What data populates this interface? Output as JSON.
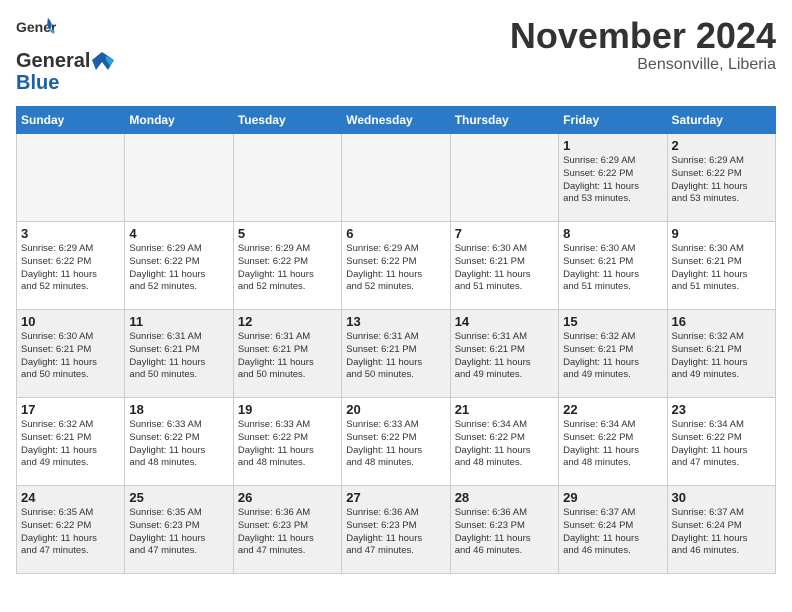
{
  "header": {
    "logo_general": "General",
    "logo_blue": "Blue",
    "month_title": "November 2024",
    "location": "Bensonville, Liberia"
  },
  "days_of_week": [
    "Sunday",
    "Monday",
    "Tuesday",
    "Wednesday",
    "Thursday",
    "Friday",
    "Saturday"
  ],
  "weeks": [
    [
      {
        "day": "",
        "info": "",
        "empty": true
      },
      {
        "day": "",
        "info": "",
        "empty": true
      },
      {
        "day": "",
        "info": "",
        "empty": true
      },
      {
        "day": "",
        "info": "",
        "empty": true
      },
      {
        "day": "",
        "info": "",
        "empty": true
      },
      {
        "day": "1",
        "info": "Sunrise: 6:29 AM\nSunset: 6:22 PM\nDaylight: 11 hours\nand 53 minutes."
      },
      {
        "day": "2",
        "info": "Sunrise: 6:29 AM\nSunset: 6:22 PM\nDaylight: 11 hours\nand 53 minutes."
      }
    ],
    [
      {
        "day": "3",
        "info": "Sunrise: 6:29 AM\nSunset: 6:22 PM\nDaylight: 11 hours\nand 52 minutes."
      },
      {
        "day": "4",
        "info": "Sunrise: 6:29 AM\nSunset: 6:22 PM\nDaylight: 11 hours\nand 52 minutes."
      },
      {
        "day": "5",
        "info": "Sunrise: 6:29 AM\nSunset: 6:22 PM\nDaylight: 11 hours\nand 52 minutes."
      },
      {
        "day": "6",
        "info": "Sunrise: 6:29 AM\nSunset: 6:22 PM\nDaylight: 11 hours\nand 52 minutes."
      },
      {
        "day": "7",
        "info": "Sunrise: 6:30 AM\nSunset: 6:21 PM\nDaylight: 11 hours\nand 51 minutes."
      },
      {
        "day": "8",
        "info": "Sunrise: 6:30 AM\nSunset: 6:21 PM\nDaylight: 11 hours\nand 51 minutes."
      },
      {
        "day": "9",
        "info": "Sunrise: 6:30 AM\nSunset: 6:21 PM\nDaylight: 11 hours\nand 51 minutes."
      }
    ],
    [
      {
        "day": "10",
        "info": "Sunrise: 6:30 AM\nSunset: 6:21 PM\nDaylight: 11 hours\nand 50 minutes."
      },
      {
        "day": "11",
        "info": "Sunrise: 6:31 AM\nSunset: 6:21 PM\nDaylight: 11 hours\nand 50 minutes."
      },
      {
        "day": "12",
        "info": "Sunrise: 6:31 AM\nSunset: 6:21 PM\nDaylight: 11 hours\nand 50 minutes."
      },
      {
        "day": "13",
        "info": "Sunrise: 6:31 AM\nSunset: 6:21 PM\nDaylight: 11 hours\nand 50 minutes."
      },
      {
        "day": "14",
        "info": "Sunrise: 6:31 AM\nSunset: 6:21 PM\nDaylight: 11 hours\nand 49 minutes."
      },
      {
        "day": "15",
        "info": "Sunrise: 6:32 AM\nSunset: 6:21 PM\nDaylight: 11 hours\nand 49 minutes."
      },
      {
        "day": "16",
        "info": "Sunrise: 6:32 AM\nSunset: 6:21 PM\nDaylight: 11 hours\nand 49 minutes."
      }
    ],
    [
      {
        "day": "17",
        "info": "Sunrise: 6:32 AM\nSunset: 6:21 PM\nDaylight: 11 hours\nand 49 minutes."
      },
      {
        "day": "18",
        "info": "Sunrise: 6:33 AM\nSunset: 6:22 PM\nDaylight: 11 hours\nand 48 minutes."
      },
      {
        "day": "19",
        "info": "Sunrise: 6:33 AM\nSunset: 6:22 PM\nDaylight: 11 hours\nand 48 minutes."
      },
      {
        "day": "20",
        "info": "Sunrise: 6:33 AM\nSunset: 6:22 PM\nDaylight: 11 hours\nand 48 minutes."
      },
      {
        "day": "21",
        "info": "Sunrise: 6:34 AM\nSunset: 6:22 PM\nDaylight: 11 hours\nand 48 minutes."
      },
      {
        "day": "22",
        "info": "Sunrise: 6:34 AM\nSunset: 6:22 PM\nDaylight: 11 hours\nand 48 minutes."
      },
      {
        "day": "23",
        "info": "Sunrise: 6:34 AM\nSunset: 6:22 PM\nDaylight: 11 hours\nand 47 minutes."
      }
    ],
    [
      {
        "day": "24",
        "info": "Sunrise: 6:35 AM\nSunset: 6:22 PM\nDaylight: 11 hours\nand 47 minutes."
      },
      {
        "day": "25",
        "info": "Sunrise: 6:35 AM\nSunset: 6:23 PM\nDaylight: 11 hours\nand 47 minutes."
      },
      {
        "day": "26",
        "info": "Sunrise: 6:36 AM\nSunset: 6:23 PM\nDaylight: 11 hours\nand 47 minutes."
      },
      {
        "day": "27",
        "info": "Sunrise: 6:36 AM\nSunset: 6:23 PM\nDaylight: 11 hours\nand 47 minutes."
      },
      {
        "day": "28",
        "info": "Sunrise: 6:36 AM\nSunset: 6:23 PM\nDaylight: 11 hours\nand 46 minutes."
      },
      {
        "day": "29",
        "info": "Sunrise: 6:37 AM\nSunset: 6:24 PM\nDaylight: 11 hours\nand 46 minutes."
      },
      {
        "day": "30",
        "info": "Sunrise: 6:37 AM\nSunset: 6:24 PM\nDaylight: 11 hours\nand 46 minutes."
      }
    ]
  ],
  "gray_rows": [
    0,
    2,
    4
  ]
}
